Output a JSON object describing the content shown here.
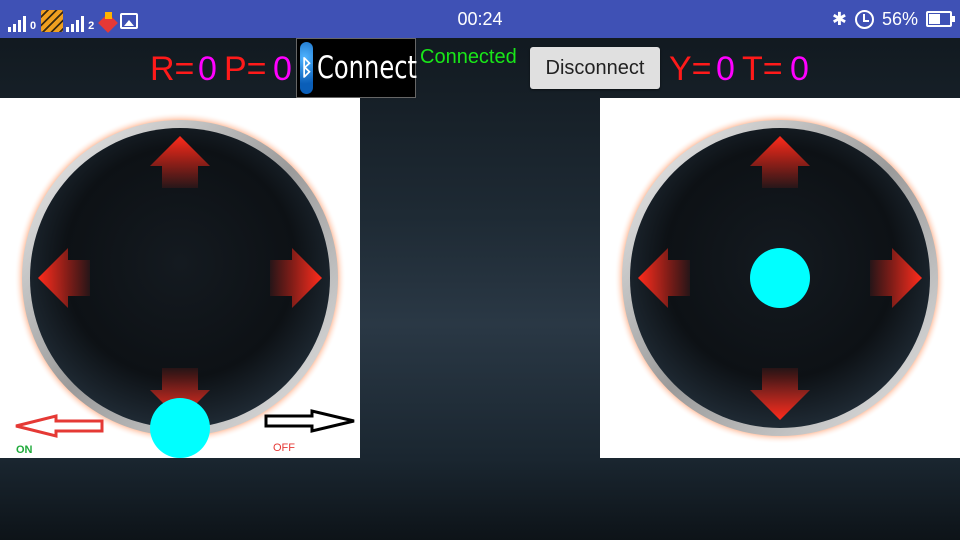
{
  "status_bar": {
    "time": "00:24",
    "sim2_label": "2",
    "battery": "56%",
    "battery_level": 0.56,
    "icons": [
      "signal-icon",
      "signal-icon",
      "tiger-app-icon",
      "box-app-icon",
      "image-icon",
      "bluetooth-icon",
      "alarm-icon",
      "battery-icon"
    ]
  },
  "controls": {
    "r_label": "R=",
    "r_value": "0",
    "p_label": "P=",
    "p_value": "0",
    "y_label": "Y=",
    "y_value": "0",
    "t_label": "T=",
    "t_value": "0",
    "connect_label": "Connect",
    "connect_status": "Connected",
    "disconnect_label": "Disconnect"
  },
  "left_joystick": {
    "on_label": "ON",
    "off_label": "OFF"
  },
  "colors": {
    "status_bar": "#3f51b5",
    "value_label": "#ff1a1a",
    "value_number": "#ff00ff",
    "connected": "#19e619",
    "knob": "#00ffff",
    "ring": "#ff3d00"
  }
}
